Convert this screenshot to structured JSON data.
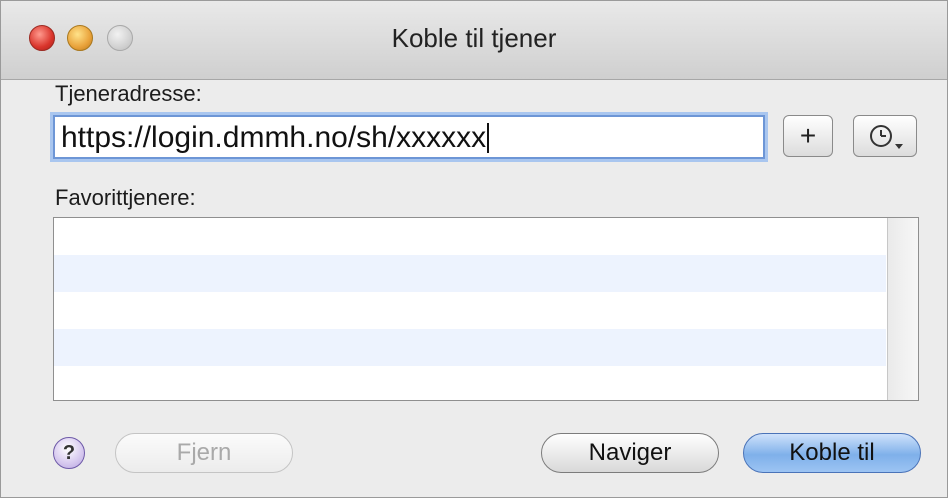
{
  "window": {
    "title": "Koble til tjener"
  },
  "form": {
    "address_label": "Tjeneradresse:",
    "address_value": "https://login.dmmh.no/sh/xxxxxx",
    "add_button": "+",
    "recent_button_icon": "clock-icon",
    "favorites_label": "Favorittjenere:",
    "favorites": []
  },
  "buttons": {
    "help": "?",
    "remove": "Fjern",
    "browse": "Naviger",
    "connect": "Koble til"
  },
  "colors": {
    "focus_ring": "#a9c6ef",
    "default_button": "#7fb0ea",
    "list_stripe": "#edf3fe"
  }
}
